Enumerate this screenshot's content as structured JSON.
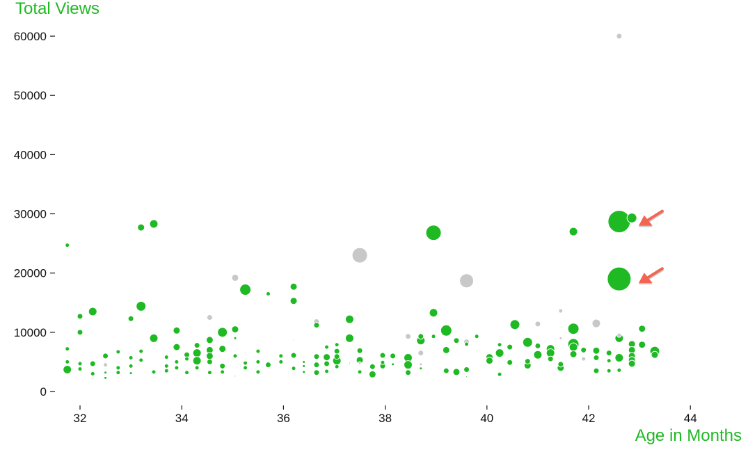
{
  "chart_data": {
    "type": "scatter",
    "title": "",
    "xlabel": "Age in Months",
    "ylabel": "Total Views",
    "xlim": [
      31.6,
      44.2
    ],
    "ylim": [
      0,
      60000
    ],
    "xticks": [
      32,
      34,
      36,
      38,
      40,
      42,
      44
    ],
    "yticks": [
      0,
      10000,
      20000,
      30000,
      40000,
      50000,
      60000
    ],
    "grid": false,
    "colors": {
      "highlight": "#1fb924",
      "other": "#c8c8c8",
      "arrow": "#f26552",
      "label": "#1fb924"
    },
    "annotations": [
      {
        "type": "arrow",
        "target_x": 42.6,
        "target_y": 28700
      },
      {
        "type": "arrow",
        "target_x": 42.6,
        "target_y": 19000
      }
    ],
    "points": [
      {
        "x": 31.75,
        "y": 24700,
        "s": 3,
        "c": "g"
      },
      {
        "x": 31.75,
        "y": 7200,
        "s": 3,
        "c": "g"
      },
      {
        "x": 31.75,
        "y": 5000,
        "s": 3,
        "c": "g"
      },
      {
        "x": 31.75,
        "y": 3700,
        "s": 6,
        "c": "g"
      },
      {
        "x": 32.0,
        "y": 12700,
        "s": 4,
        "c": "g"
      },
      {
        "x": 32.0,
        "y": 10000,
        "s": 4,
        "c": "g"
      },
      {
        "x": 32.0,
        "y": 4700,
        "s": 3,
        "c": "g"
      },
      {
        "x": 32.0,
        "y": 3800,
        "s": 3,
        "c": "g"
      },
      {
        "x": 32.25,
        "y": 13500,
        "s": 6,
        "c": "g"
      },
      {
        "x": 32.25,
        "y": 4700,
        "s": 4,
        "c": "g"
      },
      {
        "x": 32.25,
        "y": 3000,
        "s": 3,
        "c": "g"
      },
      {
        "x": 32.25,
        "y": 2200,
        "s": 1,
        "c": "g"
      },
      {
        "x": 32.5,
        "y": 6000,
        "s": 4,
        "c": "g"
      },
      {
        "x": 32.5,
        "y": 4500,
        "s": 3,
        "c": "o"
      },
      {
        "x": 32.5,
        "y": 3200,
        "s": 2,
        "c": "g"
      },
      {
        "x": 32.5,
        "y": 2300,
        "s": 2,
        "c": "g"
      },
      {
        "x": 32.75,
        "y": 6700,
        "s": 3,
        "c": "g"
      },
      {
        "x": 32.75,
        "y": 4000,
        "s": 3,
        "c": "g"
      },
      {
        "x": 32.75,
        "y": 3200,
        "s": 3,
        "c": "g"
      },
      {
        "x": 33.0,
        "y": 12300,
        "s": 4,
        "c": "g"
      },
      {
        "x": 33.0,
        "y": 5700,
        "s": 3,
        "c": "g"
      },
      {
        "x": 33.0,
        "y": 4300,
        "s": 3,
        "c": "g"
      },
      {
        "x": 33.0,
        "y": 3100,
        "s": 2,
        "c": "g"
      },
      {
        "x": 33.2,
        "y": 27700,
        "s": 5,
        "c": "g"
      },
      {
        "x": 33.2,
        "y": 14400,
        "s": 7,
        "c": "g"
      },
      {
        "x": 33.2,
        "y": 6800,
        "s": 3,
        "c": "g"
      },
      {
        "x": 33.2,
        "y": 5300,
        "s": 3,
        "c": "g"
      },
      {
        "x": 33.45,
        "y": 28300,
        "s": 6,
        "c": "g"
      },
      {
        "x": 33.45,
        "y": 9000,
        "s": 6,
        "c": "g"
      },
      {
        "x": 33.45,
        "y": 3300,
        "s": 3,
        "c": "g"
      },
      {
        "x": 33.45,
        "y": 11300,
        "s": 1,
        "c": "o"
      },
      {
        "x": 33.7,
        "y": 5800,
        "s": 3,
        "c": "g"
      },
      {
        "x": 33.7,
        "y": 4300,
        "s": 3,
        "c": "g"
      },
      {
        "x": 33.7,
        "y": 3500,
        "s": 3,
        "c": "g"
      },
      {
        "x": 33.9,
        "y": 10300,
        "s": 5,
        "c": "g"
      },
      {
        "x": 33.9,
        "y": 7500,
        "s": 5,
        "c": "g"
      },
      {
        "x": 33.9,
        "y": 5000,
        "s": 3,
        "c": "g"
      },
      {
        "x": 33.9,
        "y": 4000,
        "s": 3,
        "c": "g"
      },
      {
        "x": 34.1,
        "y": 6200,
        "s": 4,
        "c": "g"
      },
      {
        "x": 34.1,
        "y": 5500,
        "s": 3,
        "c": "g"
      },
      {
        "x": 34.1,
        "y": 3200,
        "s": 3,
        "c": "g"
      },
      {
        "x": 34.3,
        "y": 7800,
        "s": 4,
        "c": "g"
      },
      {
        "x": 34.3,
        "y": 6500,
        "s": 6,
        "c": "g"
      },
      {
        "x": 34.3,
        "y": 5200,
        "s": 6,
        "c": "g"
      },
      {
        "x": 34.3,
        "y": 4000,
        "s": 3,
        "c": "g"
      },
      {
        "x": 34.55,
        "y": 12500,
        "s": 4,
        "c": "o"
      },
      {
        "x": 34.55,
        "y": 8700,
        "s": 5,
        "c": "g"
      },
      {
        "x": 34.55,
        "y": 7000,
        "s": 5,
        "c": "g"
      },
      {
        "x": 34.55,
        "y": 6000,
        "s": 5,
        "c": "g"
      },
      {
        "x": 34.55,
        "y": 5000,
        "s": 4,
        "c": "g"
      },
      {
        "x": 34.55,
        "y": 3200,
        "s": 3,
        "c": "g"
      },
      {
        "x": 34.8,
        "y": 10000,
        "s": 7,
        "c": "g"
      },
      {
        "x": 34.8,
        "y": 7200,
        "s": 5,
        "c": "g"
      },
      {
        "x": 34.8,
        "y": 4300,
        "s": 4,
        "c": "g"
      },
      {
        "x": 34.8,
        "y": 3300,
        "s": 3,
        "c": "g"
      },
      {
        "x": 35.05,
        "y": 19200,
        "s": 5,
        "c": "o"
      },
      {
        "x": 35.05,
        "y": 10500,
        "s": 5,
        "c": "g"
      },
      {
        "x": 35.05,
        "y": 9000,
        "s": 2,
        "c": "g"
      },
      {
        "x": 35.05,
        "y": 6000,
        "s": 3,
        "c": "g"
      },
      {
        "x": 35.05,
        "y": 2600,
        "s": 1,
        "c": "g"
      },
      {
        "x": 35.25,
        "y": 17200,
        "s": 8,
        "c": "g"
      },
      {
        "x": 35.25,
        "y": 6600,
        "s": 1,
        "c": "o"
      },
      {
        "x": 35.25,
        "y": 4800,
        "s": 3,
        "c": "g"
      },
      {
        "x": 35.25,
        "y": 4000,
        "s": 3,
        "c": "g"
      },
      {
        "x": 35.5,
        "y": 6800,
        "s": 3,
        "c": "g"
      },
      {
        "x": 35.5,
        "y": 5000,
        "s": 3,
        "c": "g"
      },
      {
        "x": 35.5,
        "y": 3300,
        "s": 3,
        "c": "g"
      },
      {
        "x": 35.7,
        "y": 16500,
        "s": 3,
        "c": "g"
      },
      {
        "x": 35.7,
        "y": 4500,
        "s": 4,
        "c": "g"
      },
      {
        "x": 35.95,
        "y": 6000,
        "s": 3,
        "c": "g"
      },
      {
        "x": 35.95,
        "y": 5000,
        "s": 3,
        "c": "g"
      },
      {
        "x": 36.2,
        "y": 17700,
        "s": 5,
        "c": "g"
      },
      {
        "x": 36.2,
        "y": 15300,
        "s": 5,
        "c": "g"
      },
      {
        "x": 36.2,
        "y": 8700,
        "s": 1,
        "c": "o"
      },
      {
        "x": 36.2,
        "y": 6100,
        "s": 4,
        "c": "g"
      },
      {
        "x": 36.2,
        "y": 3900,
        "s": 3,
        "c": "g"
      },
      {
        "x": 36.4,
        "y": 5000,
        "s": 2,
        "c": "g"
      },
      {
        "x": 36.4,
        "y": 4300,
        "s": 2,
        "c": "g"
      },
      {
        "x": 36.4,
        "y": 3300,
        "s": 2,
        "c": "g"
      },
      {
        "x": 36.65,
        "y": 11800,
        "s": 4,
        "c": "o"
      },
      {
        "x": 36.65,
        "y": 11200,
        "s": 4,
        "c": "g"
      },
      {
        "x": 36.65,
        "y": 5900,
        "s": 4,
        "c": "g"
      },
      {
        "x": 36.65,
        "y": 4500,
        "s": 4,
        "c": "g"
      },
      {
        "x": 36.65,
        "y": 3200,
        "s": 4,
        "c": "g"
      },
      {
        "x": 36.85,
        "y": 7500,
        "s": 3,
        "c": "g"
      },
      {
        "x": 36.85,
        "y": 5800,
        "s": 5,
        "c": "g"
      },
      {
        "x": 36.85,
        "y": 4700,
        "s": 4,
        "c": "g"
      },
      {
        "x": 36.85,
        "y": 3400,
        "s": 3,
        "c": "g"
      },
      {
        "x": 37.05,
        "y": 7900,
        "s": 3,
        "c": "g"
      },
      {
        "x": 37.05,
        "y": 6800,
        "s": 4,
        "c": "g"
      },
      {
        "x": 37.05,
        "y": 5900,
        "s": 4,
        "c": "g"
      },
      {
        "x": 37.05,
        "y": 5200,
        "s": 6,
        "c": "g"
      },
      {
        "x": 37.05,
        "y": 4200,
        "s": 3,
        "c": "g"
      },
      {
        "x": 37.3,
        "y": 12200,
        "s": 6,
        "c": "g"
      },
      {
        "x": 37.3,
        "y": 9000,
        "s": 6,
        "c": "g"
      },
      {
        "x": 37.3,
        "y": 4800,
        "s": 1,
        "c": "g"
      },
      {
        "x": 37.5,
        "y": 23000,
        "s": 11,
        "c": "o"
      },
      {
        "x": 37.5,
        "y": 6900,
        "s": 4,
        "c": "g"
      },
      {
        "x": 37.5,
        "y": 5300,
        "s": 5,
        "c": "g"
      },
      {
        "x": 37.5,
        "y": 4800,
        "s": 2,
        "c": "o"
      },
      {
        "x": 37.5,
        "y": 3300,
        "s": 3,
        "c": "g"
      },
      {
        "x": 37.75,
        "y": 4200,
        "s": 4,
        "c": "g"
      },
      {
        "x": 37.75,
        "y": 2900,
        "s": 5,
        "c": "g"
      },
      {
        "x": 37.95,
        "y": 6100,
        "s": 4,
        "c": "g"
      },
      {
        "x": 37.95,
        "y": 4900,
        "s": 3,
        "c": "g"
      },
      {
        "x": 37.95,
        "y": 4300,
        "s": 4,
        "c": "g"
      },
      {
        "x": 38.15,
        "y": 6000,
        "s": 4,
        "c": "g"
      },
      {
        "x": 38.15,
        "y": 4600,
        "s": 2,
        "c": "g"
      },
      {
        "x": 38.45,
        "y": 9300,
        "s": 4,
        "c": "o"
      },
      {
        "x": 38.45,
        "y": 5700,
        "s": 6,
        "c": "g"
      },
      {
        "x": 38.45,
        "y": 4500,
        "s": 6,
        "c": "g"
      },
      {
        "x": 38.45,
        "y": 3200,
        "s": 4,
        "c": "g"
      },
      {
        "x": 38.7,
        "y": 8600,
        "s": 6,
        "c": "g"
      },
      {
        "x": 38.7,
        "y": 9300,
        "s": 4,
        "c": "g"
      },
      {
        "x": 38.7,
        "y": 6500,
        "s": 4,
        "c": "o"
      },
      {
        "x": 38.7,
        "y": 4600,
        "s": 2,
        "c": "o"
      },
      {
        "x": 38.7,
        "y": 3900,
        "s": 2,
        "c": "g"
      },
      {
        "x": 38.95,
        "y": 26800,
        "s": 11,
        "c": "g"
      },
      {
        "x": 38.95,
        "y": 13300,
        "s": 6,
        "c": "g"
      },
      {
        "x": 38.95,
        "y": 9300,
        "s": 3,
        "c": "g"
      },
      {
        "x": 39.2,
        "y": 10300,
        "s": 8,
        "c": "g"
      },
      {
        "x": 39.2,
        "y": 7000,
        "s": 5,
        "c": "g"
      },
      {
        "x": 39.2,
        "y": 3500,
        "s": 4,
        "c": "g"
      },
      {
        "x": 39.4,
        "y": 8600,
        "s": 4,
        "c": "g"
      },
      {
        "x": 39.4,
        "y": 10200,
        "s": 1,
        "c": "o"
      },
      {
        "x": 39.4,
        "y": 3300,
        "s": 5,
        "c": "g"
      },
      {
        "x": 39.6,
        "y": 18700,
        "s": 10,
        "c": "o"
      },
      {
        "x": 39.6,
        "y": 8400,
        "s": 4,
        "c": "o"
      },
      {
        "x": 39.6,
        "y": 8000,
        "s": 3,
        "c": "g"
      },
      {
        "x": 39.6,
        "y": 3700,
        "s": 4,
        "c": "g"
      },
      {
        "x": 39.6,
        "y": 2500,
        "s": 1,
        "c": "g"
      },
      {
        "x": 39.8,
        "y": 9300,
        "s": 3,
        "c": "g"
      },
      {
        "x": 40.05,
        "y": 5800,
        "s": 5,
        "c": "g"
      },
      {
        "x": 40.05,
        "y": 5200,
        "s": 5,
        "c": "g"
      },
      {
        "x": 40.25,
        "y": 7900,
        "s": 3,
        "c": "g"
      },
      {
        "x": 40.25,
        "y": 6500,
        "s": 6,
        "c": "g"
      },
      {
        "x": 40.25,
        "y": 9300,
        "s": 1,
        "c": "o"
      },
      {
        "x": 40.25,
        "y": 2900,
        "s": 3,
        "c": "g"
      },
      {
        "x": 40.45,
        "y": 7500,
        "s": 4,
        "c": "g"
      },
      {
        "x": 40.45,
        "y": 4900,
        "s": 4,
        "c": "g"
      },
      {
        "x": 40.55,
        "y": 11300,
        "s": 7,
        "c": "g"
      },
      {
        "x": 40.8,
        "y": 8300,
        "s": 7,
        "c": "g"
      },
      {
        "x": 40.8,
        "y": 5100,
        "s": 4,
        "c": "g"
      },
      {
        "x": 40.8,
        "y": 4400,
        "s": 5,
        "c": "g"
      },
      {
        "x": 41.0,
        "y": 11400,
        "s": 4,
        "c": "o"
      },
      {
        "x": 41.0,
        "y": 7700,
        "s": 4,
        "c": "g"
      },
      {
        "x": 41.0,
        "y": 6200,
        "s": 6,
        "c": "g"
      },
      {
        "x": 41.25,
        "y": 7200,
        "s": 6,
        "c": "g"
      },
      {
        "x": 41.25,
        "y": 6500,
        "s": 6,
        "c": "g"
      },
      {
        "x": 41.25,
        "y": 5500,
        "s": 4,
        "c": "g"
      },
      {
        "x": 41.45,
        "y": 13600,
        "s": 3,
        "c": "o"
      },
      {
        "x": 41.45,
        "y": 9000,
        "s": 2,
        "c": "o"
      },
      {
        "x": 41.45,
        "y": 4600,
        "s": 4,
        "c": "g"
      },
      {
        "x": 41.45,
        "y": 4000,
        "s": 5,
        "c": "g"
      },
      {
        "x": 41.7,
        "y": 27000,
        "s": 6,
        "c": "g"
      },
      {
        "x": 41.7,
        "y": 10600,
        "s": 8,
        "c": "g"
      },
      {
        "x": 41.7,
        "y": 8000,
        "s": 8,
        "c": "g"
      },
      {
        "x": 41.7,
        "y": 7500,
        "s": 6,
        "c": "g"
      },
      {
        "x": 41.7,
        "y": 6300,
        "s": 5,
        "c": "g"
      },
      {
        "x": 41.7,
        "y": 4300,
        "s": 1,
        "c": "o"
      },
      {
        "x": 41.9,
        "y": 7000,
        "s": 4,
        "c": "g"
      },
      {
        "x": 41.9,
        "y": 5500,
        "s": 3,
        "c": "o"
      },
      {
        "x": 42.15,
        "y": 11500,
        "s": 6,
        "c": "o"
      },
      {
        "x": 42.15,
        "y": 6900,
        "s": 5,
        "c": "g"
      },
      {
        "x": 42.15,
        "y": 5700,
        "s": 4,
        "c": "g"
      },
      {
        "x": 42.15,
        "y": 3500,
        "s": 4,
        "c": "g"
      },
      {
        "x": 42.4,
        "y": 6500,
        "s": 4,
        "c": "g"
      },
      {
        "x": 42.4,
        "y": 5200,
        "s": 3,
        "c": "g"
      },
      {
        "x": 42.4,
        "y": 3500,
        "s": 3,
        "c": "g"
      },
      {
        "x": 42.6,
        "y": 60000,
        "s": 4,
        "c": "o"
      },
      {
        "x": 42.6,
        "y": 28700,
        "s": 16,
        "c": "g"
      },
      {
        "x": 42.6,
        "y": 19000,
        "s": 17,
        "c": "g"
      },
      {
        "x": 42.6,
        "y": 9500,
        "s": 3,
        "c": "o"
      },
      {
        "x": 42.6,
        "y": 9000,
        "s": 6,
        "c": "g"
      },
      {
        "x": 42.6,
        "y": 5700,
        "s": 6,
        "c": "g"
      },
      {
        "x": 42.6,
        "y": 3600,
        "s": 3,
        "c": "g"
      },
      {
        "x": 42.85,
        "y": 29300,
        "s": 7,
        "c": "g"
      },
      {
        "x": 42.85,
        "y": 8000,
        "s": 5,
        "c": "g"
      },
      {
        "x": 42.85,
        "y": 7000,
        "s": 5,
        "c": "g"
      },
      {
        "x": 42.85,
        "y": 6000,
        "s": 5,
        "c": "g"
      },
      {
        "x": 42.85,
        "y": 5300,
        "s": 5,
        "c": "g"
      },
      {
        "x": 42.85,
        "y": 4700,
        "s": 5,
        "c": "g"
      },
      {
        "x": 43.05,
        "y": 10600,
        "s": 5,
        "c": "g"
      },
      {
        "x": 43.05,
        "y": 7900,
        "s": 5,
        "c": "g"
      },
      {
        "x": 43.3,
        "y": 6800,
        "s": 7,
        "c": "g"
      },
      {
        "x": 43.3,
        "y": 6200,
        "s": 5,
        "c": "g"
      }
    ]
  }
}
